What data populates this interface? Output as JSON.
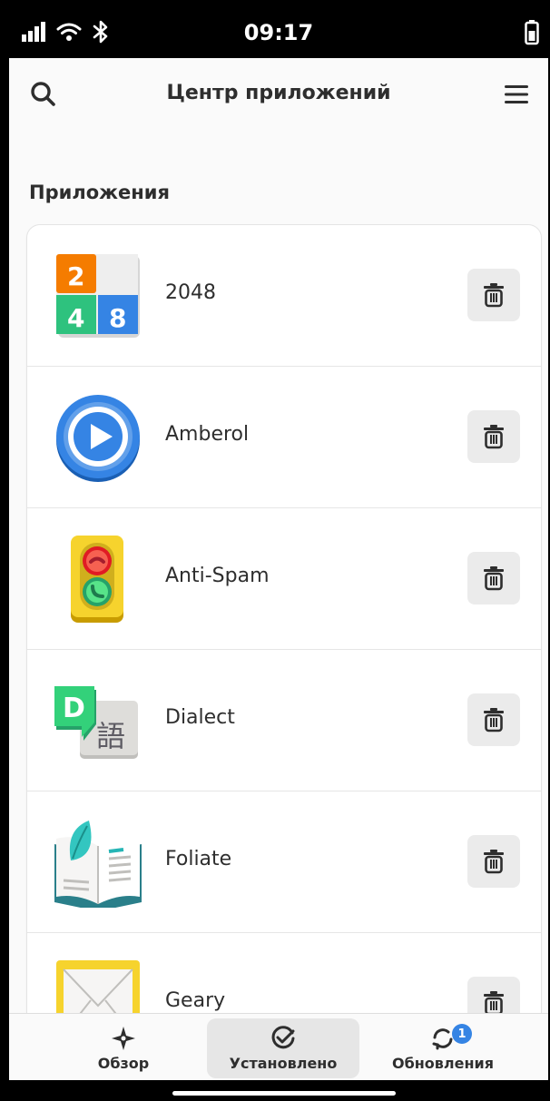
{
  "status_bar": {
    "time": "09:17",
    "icons": [
      "signal-icon",
      "wifi-icon",
      "bluetooth-icon",
      "battery-icon"
    ]
  },
  "header": {
    "title": "Центр приложений",
    "search_icon": "search-icon",
    "menu_icon": "hamburger-menu-icon"
  },
  "section": {
    "title": "Приложения"
  },
  "apps": [
    {
      "name": "2048",
      "icon": "2048-icon"
    },
    {
      "name": "Amberol",
      "icon": "amberol-icon"
    },
    {
      "name": "Anti-Spam",
      "icon": "anti-spam-icon"
    },
    {
      "name": "Dialect",
      "icon": "dialect-icon"
    },
    {
      "name": "Foliate",
      "icon": "foliate-icon"
    },
    {
      "name": "Geary",
      "icon": "geary-icon"
    }
  ],
  "icon_text": {
    "tile_2": "2",
    "tile_4": "4",
    "tile_8": "8",
    "dialect_letter": "D",
    "dialect_glyph": "語"
  },
  "bottom_nav": [
    {
      "label": "Обзор",
      "icon": "explore-icon",
      "active": false
    },
    {
      "label": "Установлено",
      "icon": "installed-check-icon",
      "active": true
    },
    {
      "label": "Обновления",
      "icon": "updates-icon",
      "active": false,
      "badge": "1"
    }
  ],
  "colors": {
    "accent": "#3584e4",
    "background": "#fafafa",
    "card": "#ffffff",
    "button_bg": "#ebebeb",
    "text": "#2e2e2e"
  }
}
